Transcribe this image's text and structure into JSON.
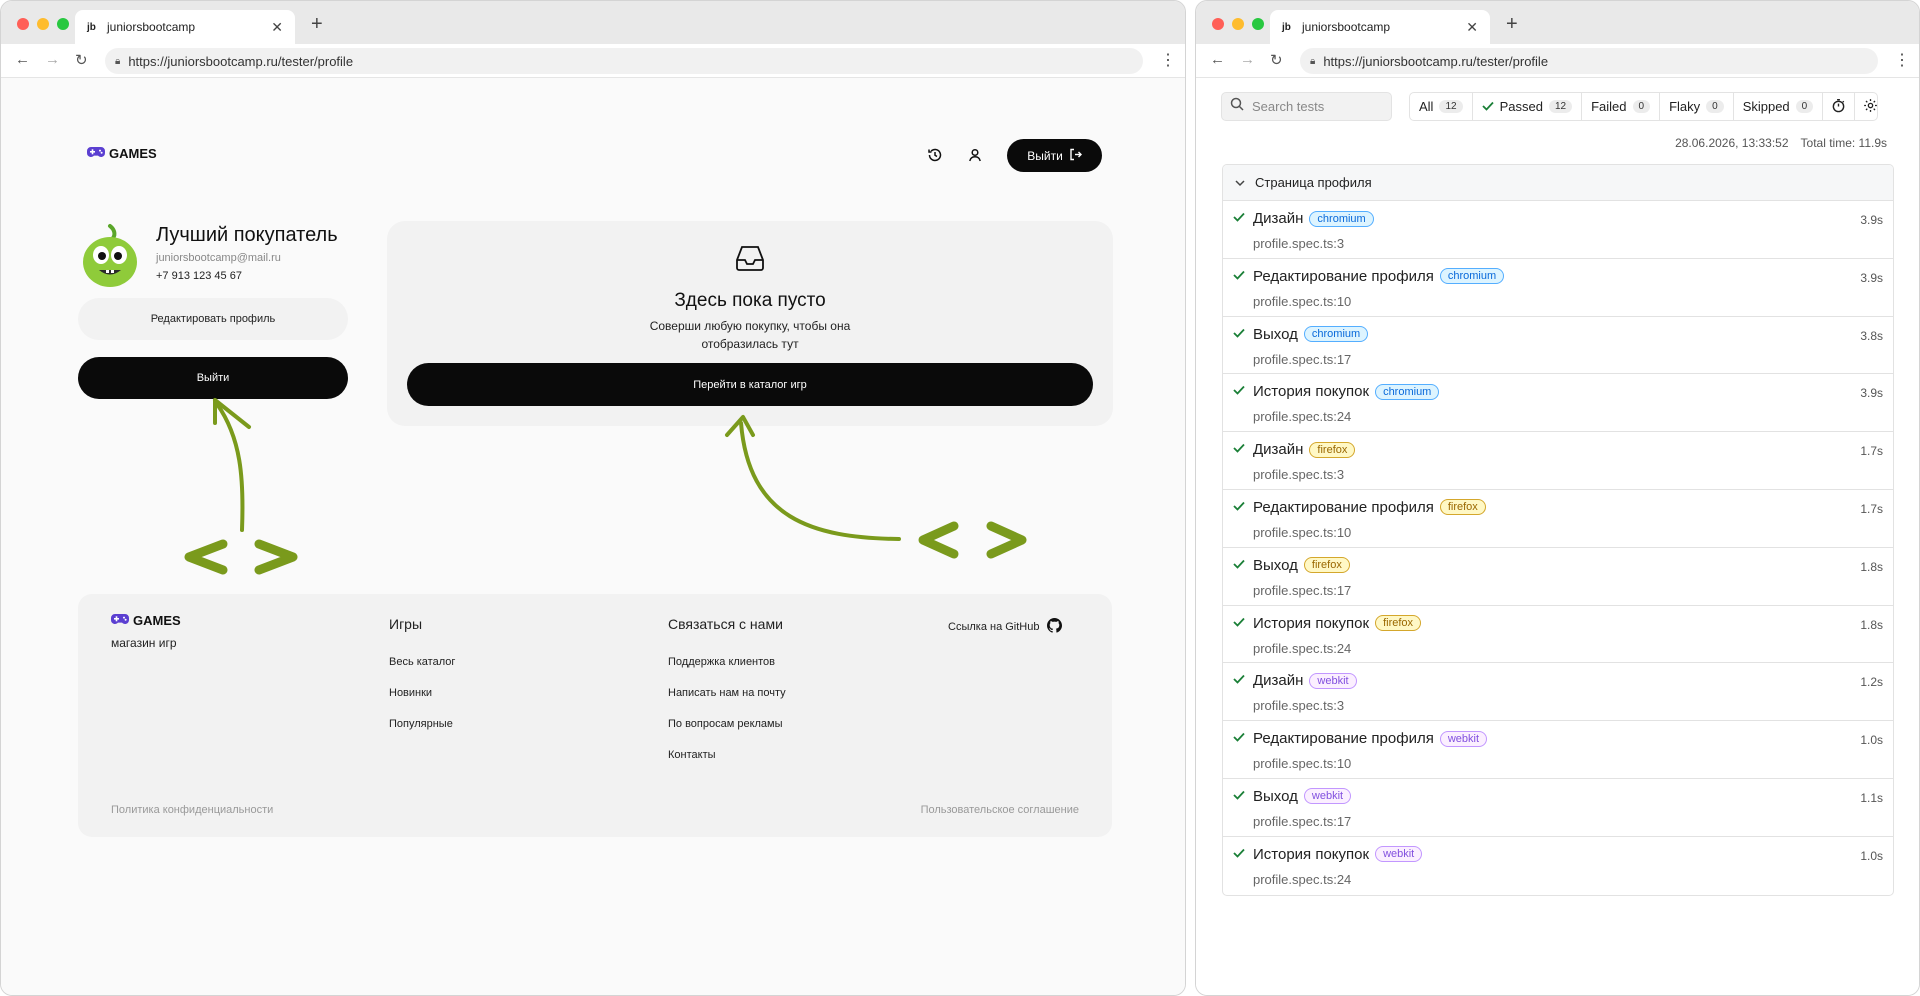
{
  "left_window": {
    "tab_favicon": "jb",
    "tab_title": "juniorsbootcamp",
    "url": "https://juniorsbootcamp.ru/tester/profile",
    "header": {
      "logo": "GAMES",
      "logout_label": "Выйти"
    },
    "profile": {
      "name": "Лучший покупатель",
      "email": "juniorsbootcamp@mail.ru",
      "phone": "+7 913 123 45 67",
      "edit_label": "Редактировать профиль",
      "logout_label": "Выйти"
    },
    "empty": {
      "title": "Здесь пока пусто",
      "subtitle": "Соверши любую покупку, чтобы она отобразилась тут",
      "button_label": "Перейти в каталог игр"
    },
    "footer": {
      "logo": "GAMES",
      "subtitle": "магазин игр",
      "games_title": "Игры",
      "games_links": [
        "Весь каталог",
        "Новинки",
        "Популярные"
      ],
      "contact_title": "Связаться с нами",
      "contact_links": [
        "Поддержка клиентов",
        "Написать нам на почту",
        "По вопросам рекламы",
        "Контакты"
      ],
      "github_label": "Ссылка на GitHub",
      "privacy": "Политика конфиденциальности",
      "agreement": "Пользовательское соглашение"
    }
  },
  "right_window": {
    "tab_favicon": "jb",
    "tab_title": "juniorsbootcamp",
    "url": "https://juniorsbootcamp.ru/tester/profile",
    "search_placeholder": "Search tests",
    "filters": [
      {
        "label": "All",
        "count": "12"
      },
      {
        "label": "Passed",
        "count": "12"
      },
      {
        "label": "Failed",
        "count": "0"
      },
      {
        "label": "Flaky",
        "count": "0"
      },
      {
        "label": "Skipped",
        "count": "0"
      }
    ],
    "date": "28.06.2026, 13:33:52",
    "total_time": "Total time: 11.9s",
    "suite_title": "Страница профиля",
    "tests": [
      {
        "name": "Дизайн",
        "browser": "chromium",
        "file": "profile.spec.ts:3",
        "duration": "3.9s"
      },
      {
        "name": "Редактирование профиля",
        "browser": "chromium",
        "file": "profile.spec.ts:10",
        "duration": "3.9s"
      },
      {
        "name": "Выход",
        "browser": "chromium",
        "file": "profile.spec.ts:17",
        "duration": "3.8s"
      },
      {
        "name": "История покупок",
        "browser": "chromium",
        "file": "profile.spec.ts:24",
        "duration": "3.9s"
      },
      {
        "name": "Дизайн",
        "browser": "firefox",
        "file": "profile.spec.ts:3",
        "duration": "1.7s"
      },
      {
        "name": "Редактирование профиля",
        "browser": "firefox",
        "file": "profile.spec.ts:10",
        "duration": "1.7s"
      },
      {
        "name": "Выход",
        "browser": "firefox",
        "file": "profile.spec.ts:17",
        "duration": "1.8s"
      },
      {
        "name": "История покупок",
        "browser": "firefox",
        "file": "profile.spec.ts:24",
        "duration": "1.8s"
      },
      {
        "name": "Дизайн",
        "browser": "webkit",
        "file": "profile.spec.ts:3",
        "duration": "1.2s"
      },
      {
        "name": "Редактирование профиля",
        "browser": "webkit",
        "file": "profile.spec.ts:10",
        "duration": "1.0s"
      },
      {
        "name": "Выход",
        "browser": "webkit",
        "file": "profile.spec.ts:17",
        "duration": "1.1s"
      },
      {
        "name": "История покупок",
        "browser": "webkit",
        "file": "profile.spec.ts:24",
        "duration": "1.0s"
      }
    ]
  },
  "colors": {
    "accent_green": "#7a9a1c",
    "pass_green": "#1a7f37",
    "dark": "#0a0a0a",
    "gamepad": "#5b3fd1"
  }
}
